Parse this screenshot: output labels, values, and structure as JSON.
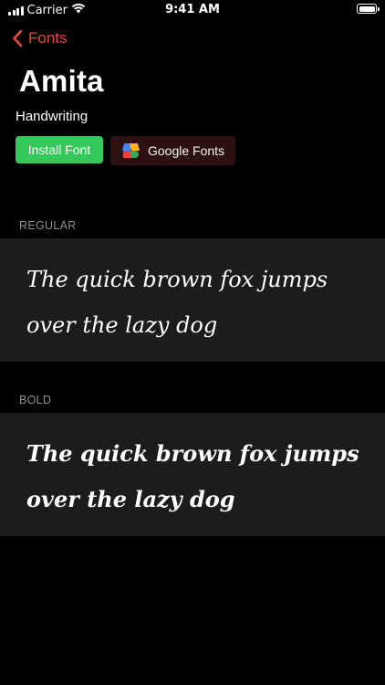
{
  "status_bar": {
    "carrier": "Carrier",
    "time": "9:41 AM",
    "icons": [
      "signal-icon",
      "wifi-icon",
      "battery-icon"
    ]
  },
  "nav": {
    "back_label": "Fonts"
  },
  "font": {
    "name": "Amita",
    "category": "Handwriting"
  },
  "actions": {
    "install_label": "Install Font",
    "google_label": "Google Fonts"
  },
  "sections": [
    {
      "header": "REGULAR",
      "sample": "The quick brown fox jumps over the lazy dog"
    },
    {
      "header": "BOLD",
      "sample": "The quick brown fox jumps over the lazy dog"
    }
  ],
  "colors": {
    "accent": "#e8453c",
    "install_button": "#34c759",
    "google_button_bg": "#2d1010",
    "cell_background": "#1c1c1e",
    "section_header": "#8e8e93"
  }
}
